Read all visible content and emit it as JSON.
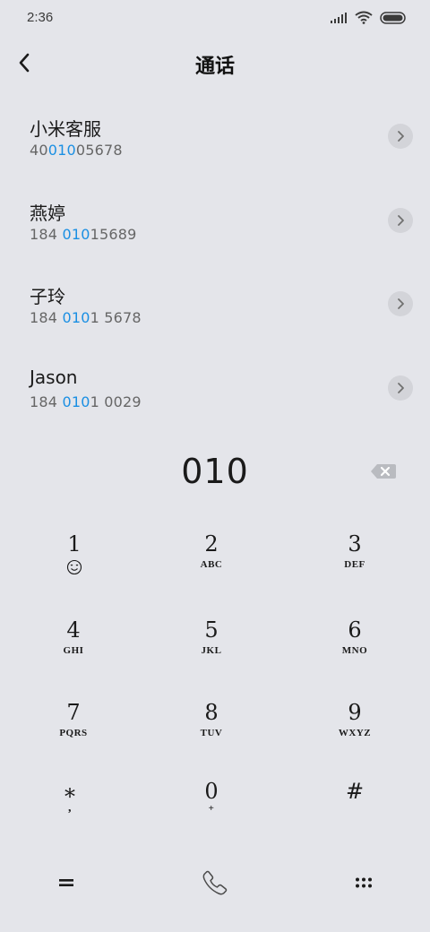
{
  "status_bar": {
    "time": "2:36",
    "icons": [
      "signal-icon",
      "wifi-icon",
      "battery-icon"
    ]
  },
  "header": {
    "title": "通话",
    "back_icon": "chevron-left-icon"
  },
  "contacts": [
    {
      "name": "小米客服",
      "number_pre": "40",
      "number_match": "010",
      "number_post": "05678"
    },
    {
      "name": "燕婷",
      "number_pre": "184 ",
      "number_match": "010",
      "number_post": "15689"
    },
    {
      "name": "子玲",
      "number_pre": "184 ",
      "number_match": "010",
      "number_post": "1 5678"
    },
    {
      "name": "Jason",
      "number_pre": "184 ",
      "number_match": "010",
      "number_post": "1 0029"
    }
  ],
  "dialer": {
    "digits": "010"
  },
  "keypad": {
    "keys": [
      {
        "digit": "1",
        "letters": ""
      },
      {
        "digit": "2",
        "letters": "ABC"
      },
      {
        "digit": "3",
        "letters": "DEF"
      },
      {
        "digit": "4",
        "letters": "GHI"
      },
      {
        "digit": "5",
        "letters": "JKL"
      },
      {
        "digit": "6",
        "letters": "MNO"
      },
      {
        "digit": "7",
        "letters": "PQRS"
      },
      {
        "digit": "8",
        "letters": "TUV"
      },
      {
        "digit": "9",
        "letters": "WXYZ"
      },
      {
        "digit": "*",
        "letters": ","
      },
      {
        "digit": "0",
        "letters": "+"
      },
      {
        "digit": "#",
        "letters": ""
      }
    ]
  },
  "colors": {
    "background": "#e4e5ea",
    "highlight": "#1a8fe3",
    "detail_button": "#d3d4d9",
    "backspace": "#b9bbc0"
  }
}
